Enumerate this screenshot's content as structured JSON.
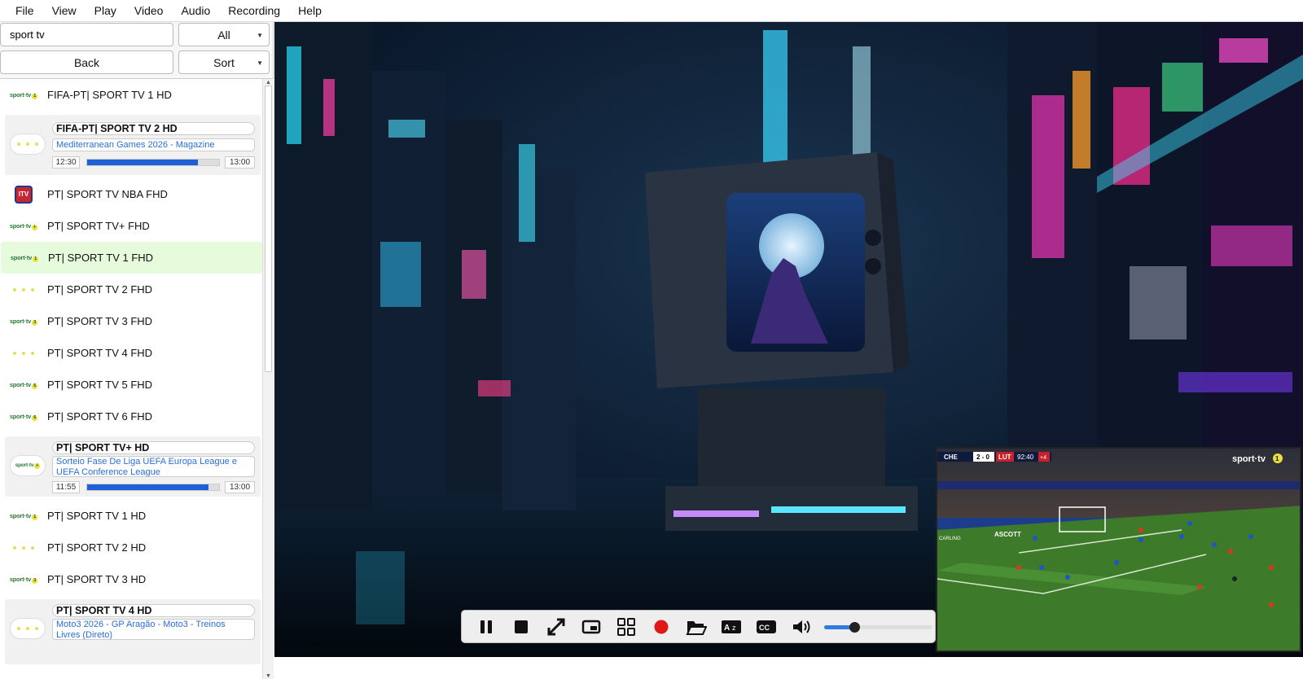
{
  "menu": [
    "File",
    "View",
    "Play",
    "Video",
    "Audio",
    "Recording",
    "Help"
  ],
  "search": {
    "value": "sport tv"
  },
  "filter_select": {
    "value": "All"
  },
  "back_label": "Back",
  "sort_select": {
    "value": "Sort"
  },
  "channels": [
    {
      "name": "FIFA-PT| SPORT TV 1 HD",
      "logo": "sporttv-1-logo",
      "logo_text": "sport·tv",
      "logo_num": "1"
    },
    {
      "name": "PT| SPORT TV NBA FHD",
      "logo": "nba-tv-logo",
      "logo_text": "ITV"
    },
    {
      "name": "PT| SPORT TV+ FHD",
      "logo": "sporttv-plus-logo",
      "logo_text": "sport·tv",
      "logo_num": "+"
    },
    {
      "name": "PT| SPORT TV 1 FHD",
      "logo": "sporttv-1-logo",
      "logo_text": "sport·tv",
      "logo_num": "1",
      "selected": true
    },
    {
      "name": "PT| SPORT TV 2 FHD",
      "logo": "dots-logo"
    },
    {
      "name": "PT| SPORT TV 3 FHD",
      "logo": "sporttv-3-logo",
      "logo_text": "sport·tv",
      "logo_num": "3"
    },
    {
      "name": "PT| SPORT TV 4 FHD",
      "logo": "dots-logo"
    },
    {
      "name": "PT| SPORT TV 5 FHD",
      "logo": "sporttv-5-logo",
      "logo_text": "sport·tv",
      "logo_num": "5"
    },
    {
      "name": "PT| SPORT TV 6 FHD",
      "logo": "sporttv-6-logo",
      "logo_text": "sport·tv",
      "logo_num": "6"
    },
    {
      "name": "PT| SPORT TV 1 HD",
      "logo": "sporttv-1-logo",
      "logo_text": "sport·tv",
      "logo_num": "1"
    },
    {
      "name": "PT| SPORT TV 2 HD",
      "logo": "dots-logo"
    },
    {
      "name": "PT| SPORT TV 3 HD",
      "logo": "sporttv-3-logo",
      "logo_text": "sport·tv",
      "logo_num": "3"
    }
  ],
  "cards": [
    {
      "name": "FIFA-PT| SPORT TV 2 HD",
      "program": "Mediterranean Games 2026 - Magazine",
      "start": "12:30",
      "end": "13:00",
      "progress": 0.84
    },
    {
      "name": "PT| SPORT TV+ HD",
      "program": "Sorteio Fase De Liga UEFA Europa League e UEFA Conference League",
      "start": "11:55",
      "end": "13:00",
      "progress": 0.92
    },
    {
      "name": "PT| SPORT TV 4 HD",
      "program": "Moto3 2026 - GP Aragão - Moto3 - Treinos Livres (Direto)"
    }
  ],
  "pip_overlay": {
    "home": "CHE",
    "score": "2 - 0",
    "away": "LUT",
    "clock": "92:40",
    "added": "+4",
    "channel_logo": "sport·tv",
    "channel_num": "1",
    "board_1": "ASCOTT",
    "board_2": "CARLING"
  },
  "controls": [
    "pause-icon",
    "stop-icon",
    "fullscreen-icon",
    "pip-icon",
    "grid-icon",
    "record-icon",
    "open-folder-icon",
    "audio-track-icon",
    "subtitles-icon",
    "volume-icon"
  ],
  "volume": 0.28,
  "colors": {
    "accent": "#2f7be0",
    "selected_row": "#e6fbdc",
    "record": "#e01818",
    "link": "#2a6fd6"
  }
}
